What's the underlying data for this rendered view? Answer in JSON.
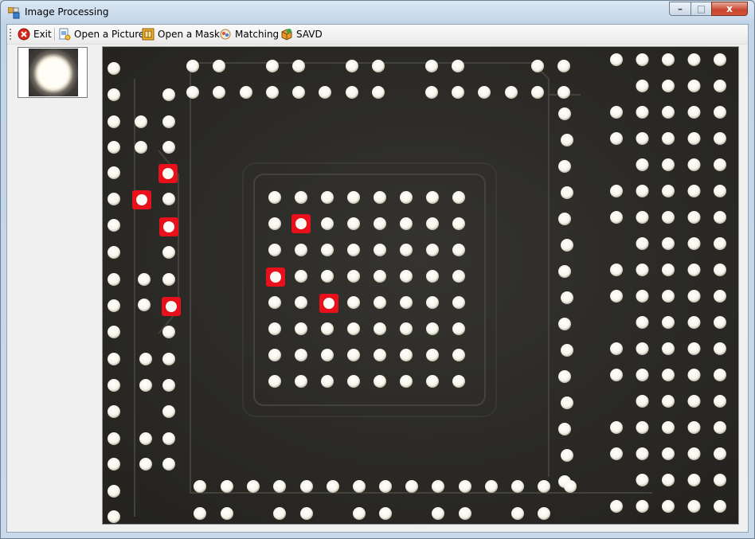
{
  "window": {
    "title": "Image Processing",
    "controls": {
      "minimize": "–",
      "maximize": "□",
      "close": "x"
    }
  },
  "toolbar": {
    "items": [
      {
        "label": "Exit",
        "icon": "exit-icon"
      },
      {
        "label": "Open a Picture",
        "icon": "open-picture-icon"
      },
      {
        "label": "Open a Mask",
        "icon": "open-mask-icon"
      },
      {
        "label": "Matching",
        "icon": "matching-icon"
      },
      {
        "label": "SAVD",
        "icon": "save-icon"
      }
    ]
  },
  "mask_preview": {
    "icon": "mask-thumbnail-image"
  },
  "colors": {
    "match_marker": "#e8101a",
    "board": "#2c2b28",
    "pad": "#fbfaf4"
  }
}
